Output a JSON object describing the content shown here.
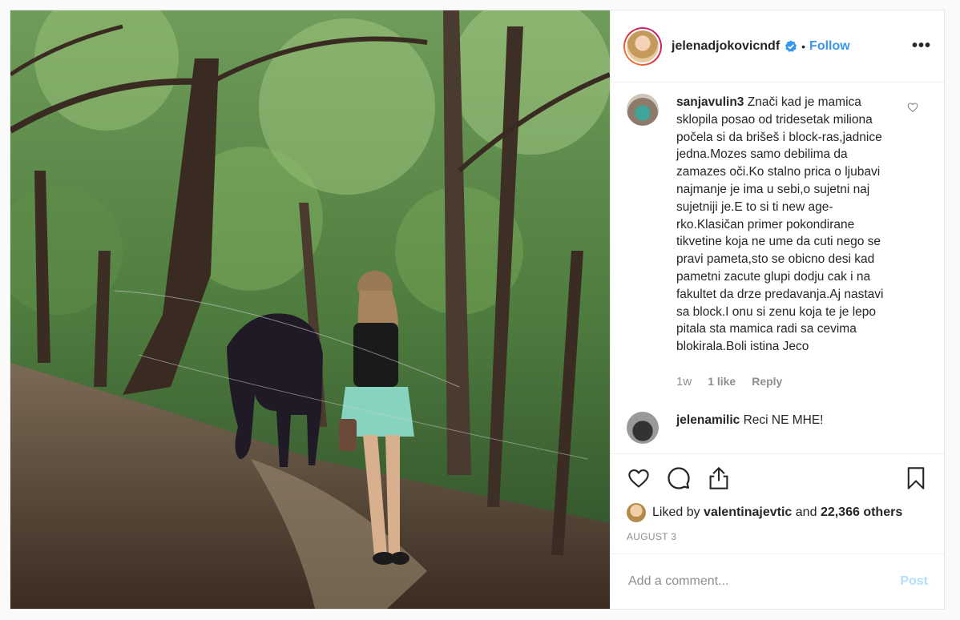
{
  "post": {
    "author": {
      "username": "jelenadjokovicndf",
      "verified": true,
      "follow_label": "Follow",
      "separator": "•"
    },
    "more_label": "•••",
    "comments": [
      {
        "username": "sanjavulin3",
        "text": "Znači kad je mamica sklopila posao od tridesetak miliona počela si da brišeš i block-ras,jadnice jedna.Mozes samo debilima da zamazes oči.Ko stalno prica o ljubavi najmanje je ima u sebi,o sujetni naj sujetniji je.E to si ti new age-rko.Klasičan primer pokondirane tikvetine koja ne ume da cuti nego se pravi pameta,sto se obicno desi kad pametni zacute glupi dodju cak i na fakultet da drze predavanja.Aj nastavi sa block.I onu si zenu koja te je lepo pitala sta mamica radi sa cevima blokirala.Boli istina Jeco",
        "time": "1w",
        "likes": "1 like",
        "reply_label": "Reply"
      },
      {
        "username": "jelenamilic",
        "text": "Reci NE MHE!"
      }
    ],
    "liked_by": {
      "prefix": "Liked by",
      "user": "valentinajevtic",
      "conjunction": "and",
      "others": "22,366 others"
    },
    "date": "AUGUST 3",
    "add_comment": {
      "placeholder": "Add a comment...",
      "post_label": "Post"
    },
    "icons": [
      "heart-icon",
      "comment-icon",
      "share-icon",
      "bookmark-icon",
      "verified-badge-icon",
      "small-heart-icon"
    ],
    "colors": {
      "link_blue": "#3897f0",
      "post_disabled": "#b2dffc",
      "muted": "#8e8e8e",
      "text": "#262626"
    }
  }
}
